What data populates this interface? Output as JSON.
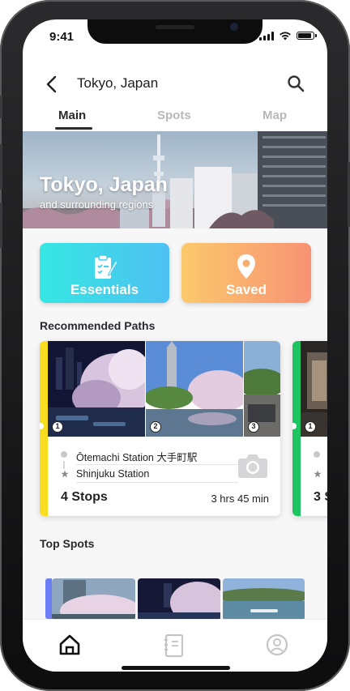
{
  "status_bar": {
    "time": "9:41"
  },
  "header": {
    "title": "Tokyo, Japan",
    "back_icon": "chevron-left-icon",
    "search_icon": "search-icon"
  },
  "tabs": [
    {
      "label": "Main",
      "active": true
    },
    {
      "label": "Spots",
      "active": false
    },
    {
      "label": "Map",
      "active": false
    }
  ],
  "hero": {
    "title": "Tokyo, Japan",
    "subtitle": "and surrounding regions"
  },
  "categories": [
    {
      "label": "Essentials",
      "icon": "clipboard-check-icon",
      "colors": [
        "#35e7e2",
        "#4fc0f2"
      ]
    },
    {
      "label": "Saved",
      "icon": "map-pin-icon",
      "colors": [
        "#fbc96c",
        "#f89274"
      ]
    }
  ],
  "recommended": {
    "title": "Recommended Paths",
    "cards": [
      {
        "accent": "#f7dc1f",
        "photos": [
          {
            "badge": "1"
          },
          {
            "badge": "2"
          },
          {
            "badge": "3"
          }
        ],
        "start": "Ōtemachi Station 大手町駅",
        "end": "Shinjuku Station",
        "stops": "4 Stops",
        "duration": "3 hrs 45 min",
        "camera_icon": "camera-icon"
      },
      {
        "accent": "#1dc45f",
        "photos": [
          {
            "badge": "1"
          }
        ],
        "stops": "3 S"
      }
    ]
  },
  "top_spots": {
    "title": "Top Spots",
    "accent": "#6b7cf5"
  },
  "tabbar": [
    {
      "icon": "home-icon",
      "active": true
    },
    {
      "icon": "notebook-icon",
      "active": false
    },
    {
      "icon": "profile-icon",
      "active": false
    }
  ]
}
